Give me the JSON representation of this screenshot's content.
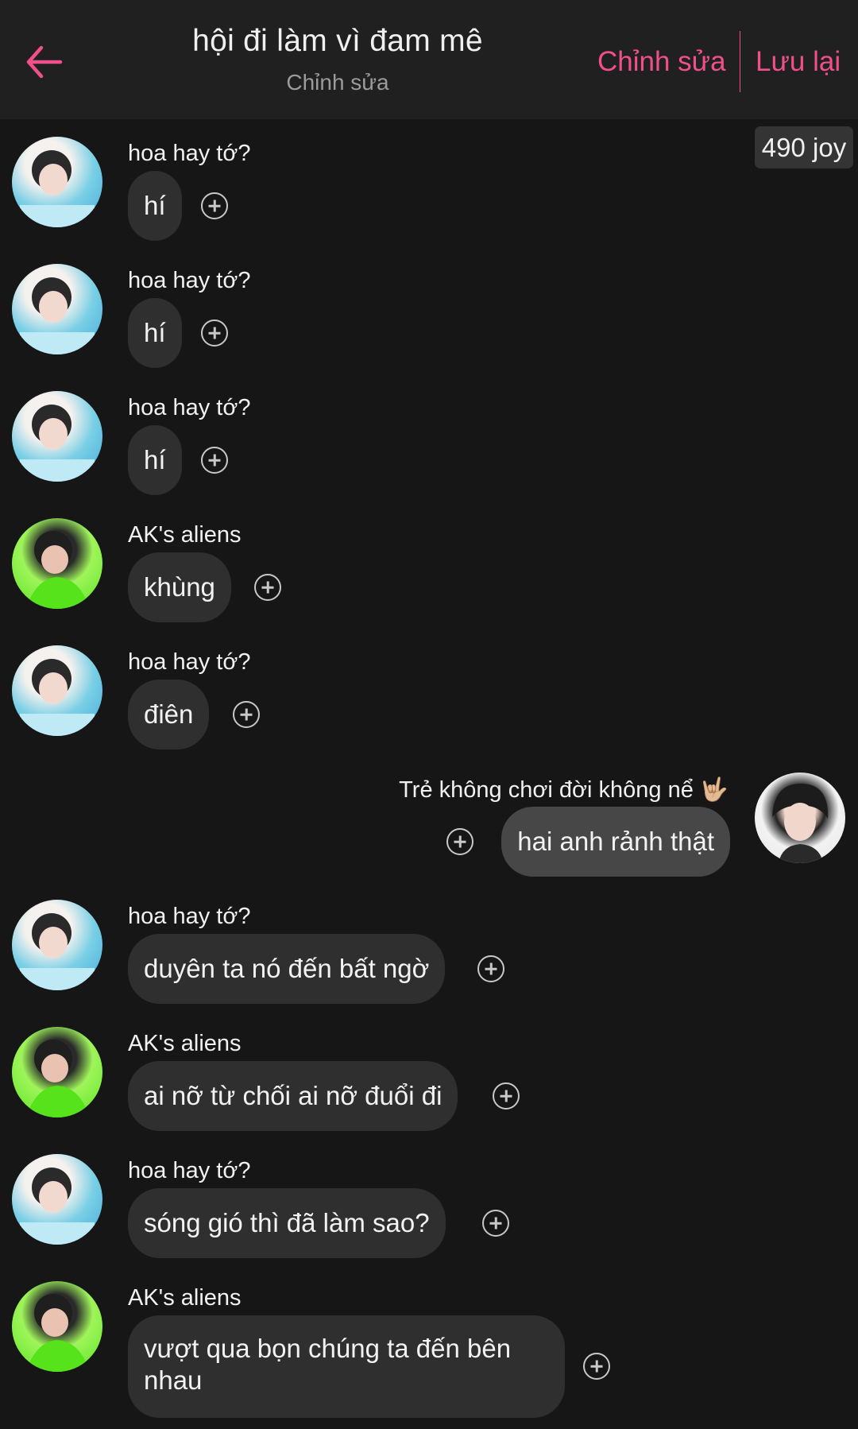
{
  "header": {
    "title": "hội đi làm vì đam mê",
    "subtitle": "Chỉnh sửa",
    "edit_label": "Chỉnh sửa",
    "save_label": "Lưu lại"
  },
  "joy_badge": "490 joy",
  "messages": [
    {
      "sender": "hoa hay tớ?",
      "text": "hí"
    },
    {
      "sender": "hoa hay tớ?",
      "text": "hí"
    },
    {
      "sender": "hoa hay tớ?",
      "text": "hí"
    },
    {
      "sender": "AK's aliens",
      "text": "khùng"
    },
    {
      "sender": "hoa hay tớ?",
      "text": "điên"
    },
    {
      "sender": "Trẻ không chơi đời không nể 🤟🏼",
      "text": "hai anh rảnh thật"
    },
    {
      "sender": "hoa hay tớ?",
      "text": "duyên ta nó đến bất ngờ"
    },
    {
      "sender": "AK's aliens",
      "text": "ai nỡ từ chối ai nỡ đuổi đi"
    },
    {
      "sender": "hoa hay tớ?",
      "text": "sóng gió thì đã làm sao?"
    },
    {
      "sender": "AK's aliens",
      "text": "vượt qua bọn chúng ta đến bên nhau"
    }
  ],
  "colors": {
    "accent": "#f0508a",
    "background": "#161616",
    "header_background": "#202020",
    "bubble": "#2f2f2f",
    "my_bubble": "#474747"
  }
}
